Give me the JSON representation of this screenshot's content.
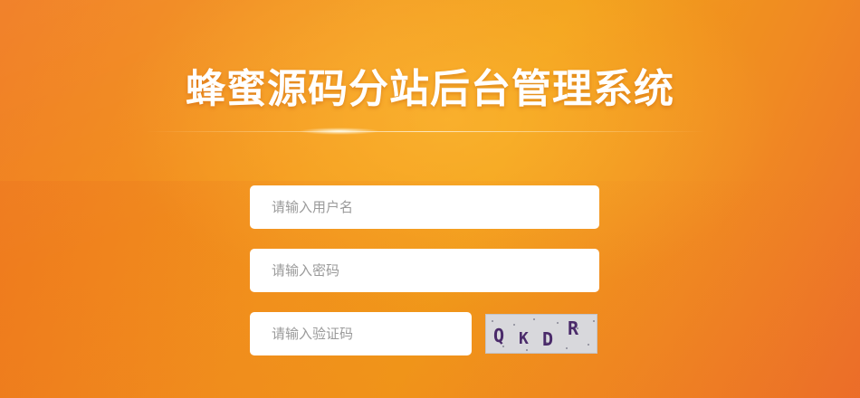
{
  "page": {
    "title": "蜂蜜源码分站后台管理系统"
  },
  "login_form": {
    "username_placeholder": "请输入用户名",
    "password_placeholder": "请输入密码",
    "captcha_placeholder": "请输入验证码",
    "captcha_text": "QKDR"
  },
  "colors": {
    "background_orange": "#f39a1c",
    "title_text": "#ffffff",
    "captcha_glyph": "#4a2a6a"
  }
}
